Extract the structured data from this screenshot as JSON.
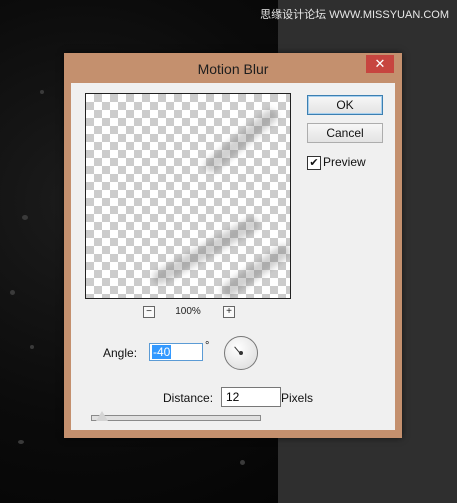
{
  "watermark": "思缘设计论坛 WWW.MISSYUAN.COM",
  "dialog": {
    "title": "Motion Blur",
    "close_glyph": "✕",
    "ok_label": "OK",
    "cancel_label": "Cancel",
    "preview_label": "Preview",
    "preview_checked": true,
    "preview_check_glyph": "✔",
    "zoom_out_glyph": "−",
    "zoom_in_glyph": "+",
    "zoom_level": "100%",
    "angle_label": "Angle:",
    "angle_value": "-40",
    "degree_symbol": "°",
    "distance_label": "Distance:",
    "distance_value": "12",
    "distance_unit": "Pixels"
  },
  "colors": {
    "frame": "#c4906e",
    "close": "#c7453f",
    "client": "#f0f0f0",
    "selection": "#3399ff"
  }
}
